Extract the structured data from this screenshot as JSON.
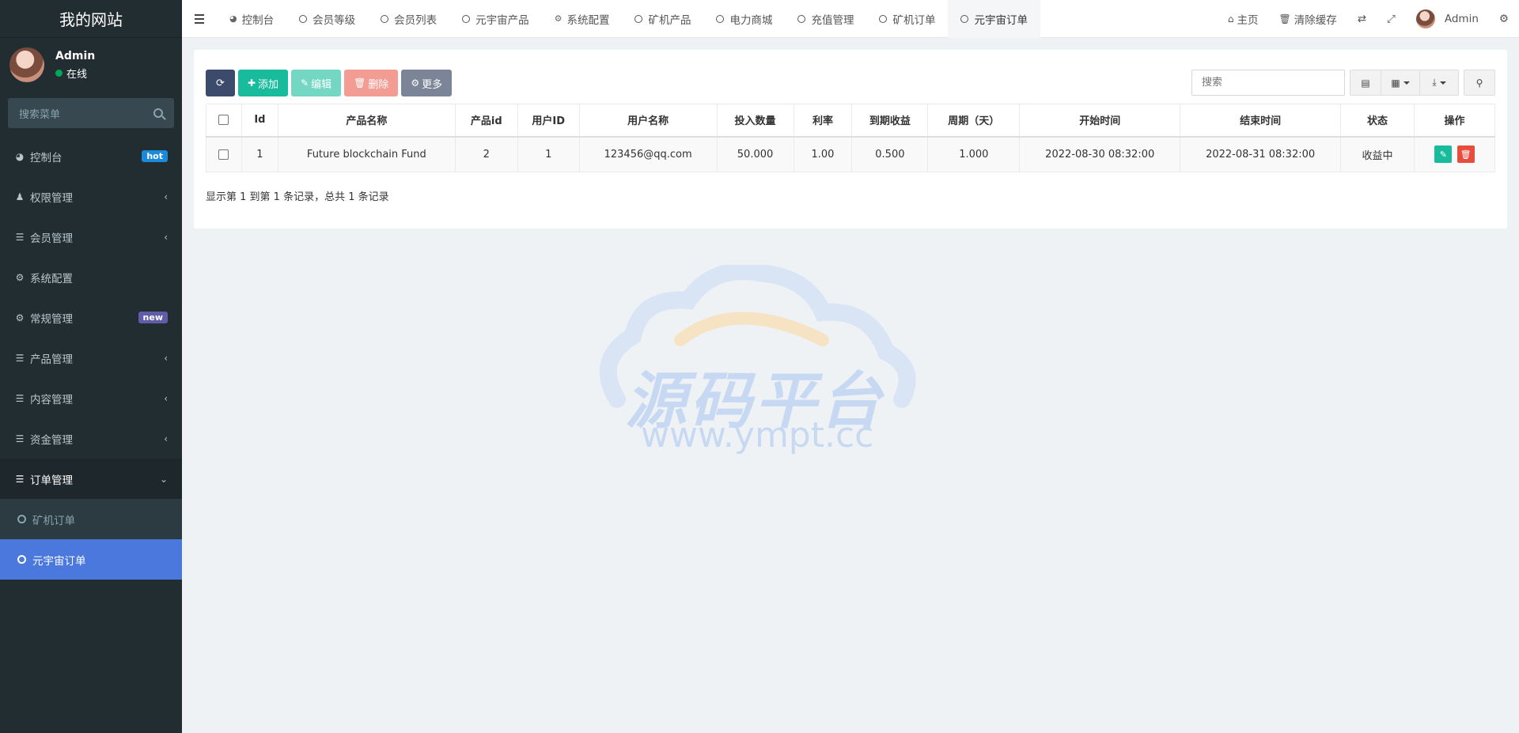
{
  "sidebar": {
    "brand": "我的网站",
    "user": {
      "name": "Admin",
      "status": "在线"
    },
    "search_placeholder": "搜索菜单",
    "items": [
      {
        "label": "控制台",
        "icon": "dashboard-icon",
        "badge": "hot"
      },
      {
        "label": "权限管理",
        "icon": "users-icon"
      },
      {
        "label": "会员管理",
        "icon": "list-icon"
      },
      {
        "label": "系统配置",
        "icon": "gear-icon"
      },
      {
        "label": "常规管理",
        "icon": "cogs-icon",
        "badge": "new"
      },
      {
        "label": "产品管理",
        "icon": "list-icon"
      },
      {
        "label": "内容管理",
        "icon": "list-icon"
      },
      {
        "label": "资金管理",
        "icon": "list-icon"
      },
      {
        "label": "订单管理",
        "icon": "list-icon"
      }
    ],
    "submenu": [
      {
        "label": "矿机订单"
      },
      {
        "label": "元宇宙订单"
      }
    ]
  },
  "topnav": {
    "tabs": [
      {
        "label": "控制台",
        "icon": "dashboard-icon"
      },
      {
        "label": "会员等级",
        "icon": "circle-icon"
      },
      {
        "label": "会员列表",
        "icon": "circle-icon"
      },
      {
        "label": "元宇宙产品",
        "icon": "circle-icon"
      },
      {
        "label": "系统配置",
        "icon": "gear-icon"
      },
      {
        "label": "矿机产品",
        "icon": "circle-icon"
      },
      {
        "label": "电力商城",
        "icon": "circle-icon"
      },
      {
        "label": "充值管理",
        "icon": "circle-icon"
      },
      {
        "label": "矿机订单",
        "icon": "circle-icon"
      },
      {
        "label": "元宇宙订单",
        "icon": "circle-icon"
      }
    ],
    "home": "主页",
    "clear_cache": "清除缓存",
    "admin": "Admin"
  },
  "toolbar": {
    "add": "添加",
    "edit": "编辑",
    "delete": "删除",
    "more": "更多",
    "search_placeholder": "搜索"
  },
  "table": {
    "headers": [
      "Id",
      "产品名称",
      "产品id",
      "用户ID",
      "用户名称",
      "投入数量",
      "利率",
      "到期收益",
      "周期（天）",
      "开始时间",
      "结束时间",
      "状态",
      "操作"
    ],
    "rows": [
      [
        "1",
        "Future blockchain Fund",
        "2",
        "1",
        "123456@qq.com",
        "50.000",
        "1.00",
        "0.500",
        "1.000",
        "2022-08-30 08:32:00",
        "2022-08-31 08:32:00",
        "收益中"
      ]
    ]
  },
  "pagination": "显示第 1 到第 1 条记录，总共 1 条记录",
  "watermark": {
    "title": "源码平台",
    "url": "www.ympt.cc"
  }
}
